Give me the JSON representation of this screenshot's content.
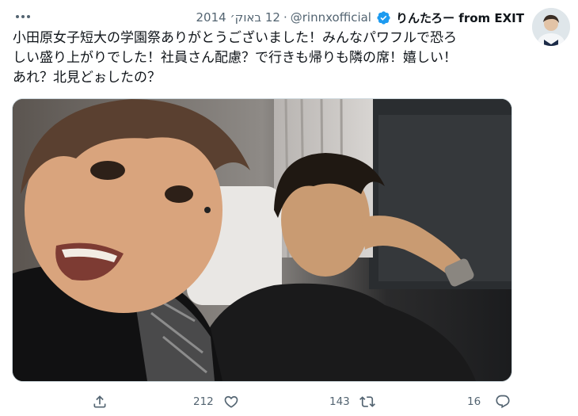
{
  "tweet": {
    "display_name": "りんたろー from EXIT",
    "handle": "@rinnxofficial",
    "separator": "·",
    "date": "12 באוק׳ 2014",
    "text": "小田原女子短大の学園祭ありがとうございました！みんなパワフルで恐ろ\nしい盛り上がりでした！社員さん配慮？で行きも帰りも隣の席！嬉しい！\nあれ？北見どぉしたの？",
    "icons": {
      "verified": "verified-badge-icon",
      "more": "more-horizontal-icon",
      "share": "share-icon",
      "like": "heart-icon",
      "retweet": "retweet-icon",
      "reply": "reply-icon"
    },
    "colors": {
      "verified": "#1d9bf0",
      "secondary_text": "#536471",
      "primary_text": "#0f1419"
    }
  },
  "actions": {
    "likes": "212",
    "retweets": "143",
    "replies": "16"
  }
}
